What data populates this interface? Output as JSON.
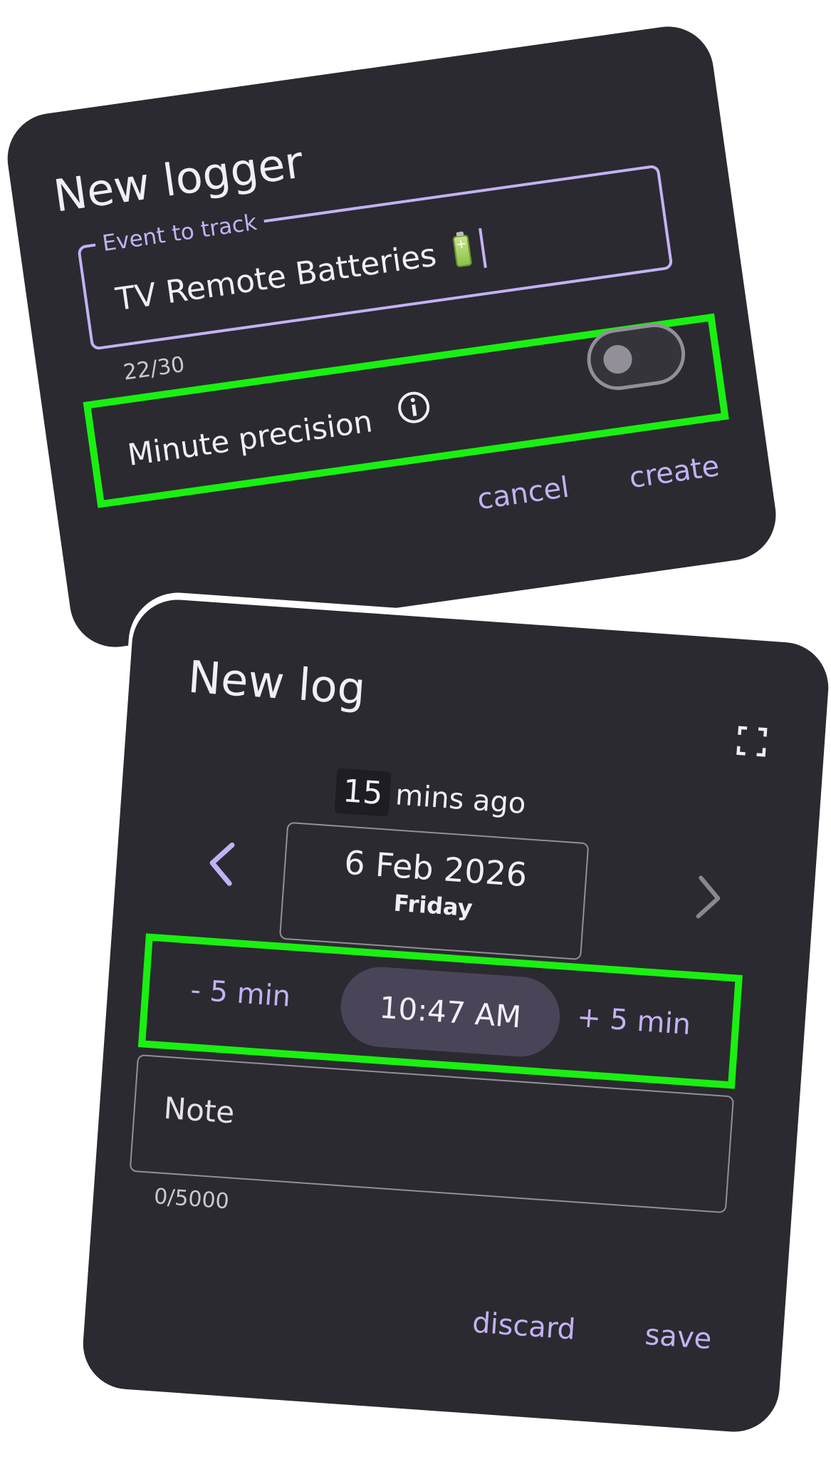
{
  "new_logger": {
    "title": "New logger",
    "event_field": {
      "label": "Event to track",
      "value": "TV Remote Batteries",
      "value_emoji_icon": "battery-icon",
      "counter": "22/30"
    },
    "minute_precision": {
      "label": "Minute precision",
      "info_icon": "info-icon",
      "toggle_on": false
    },
    "actions": {
      "cancel": "cancel",
      "create": "create"
    },
    "colors": {
      "surface": "#2b2a30",
      "accent": "#c4b1f5",
      "highlight": "#19f011"
    }
  },
  "new_log": {
    "title": "New log",
    "fullscreen_icon": "fullscreen-icon",
    "mins_ago": {
      "number": "15",
      "text": "mins ago"
    },
    "date": {
      "main": "6 Feb 2026",
      "weekday": "Friday",
      "prev_icon": "chevron-left-icon",
      "next_icon": "chevron-right-icon"
    },
    "time": {
      "minus": "- 5 min",
      "value": "10:47 AM",
      "plus": "+ 5 min"
    },
    "note": {
      "placeholder": "Note",
      "counter": "0/5000"
    },
    "actions": {
      "discard": "discard",
      "save": "save"
    },
    "colors": {
      "pill": "#4a4458",
      "accent": "#c4b1f5"
    }
  }
}
